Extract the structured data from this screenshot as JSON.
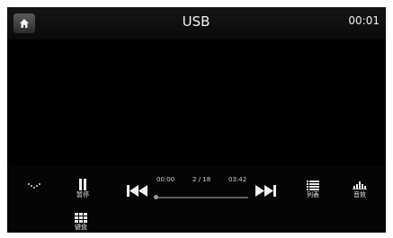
{
  "header": {
    "title": "USB",
    "clock": "00:01"
  },
  "controls": {
    "pause_label": "暂停",
    "list_label": "列表",
    "eq_label": "音效",
    "keypad_label": "键盘"
  },
  "progress": {
    "elapsed": "00:00",
    "track": "2 / 18",
    "total": "03:42",
    "position": 0
  },
  "icons": {
    "home": "home-icon",
    "mode": "mode-icon",
    "pause": "pause-icon",
    "prev": "previous-track-icon",
    "next": "next-track-icon",
    "list": "list-icon",
    "eq": "equalizer-icon",
    "keypad": "keypad-icon"
  }
}
